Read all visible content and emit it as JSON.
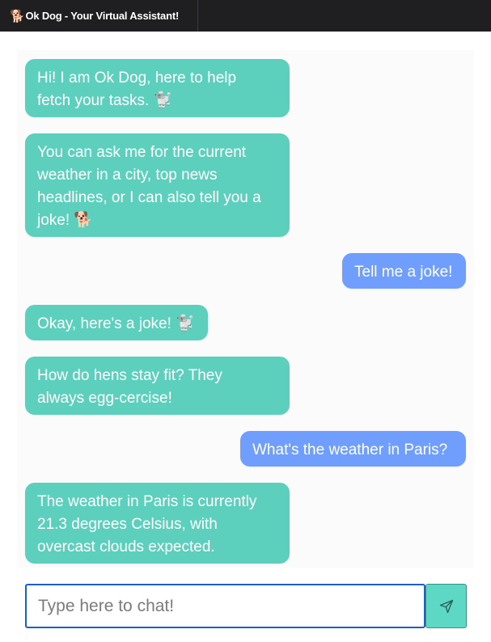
{
  "header": {
    "title": "Ok Dog - Your Virtual Assistant!",
    "icon": "dog-icon"
  },
  "messages": [
    {
      "sender": "bot",
      "text": "Hi! I am Ok Dog, here to help\nfetch your tasks. 🐩"
    },
    {
      "sender": "bot",
      "text": "You can ask me for the current\nweather in a city, top news\nheadlines, or I can also tell you a\njoke! 🐕"
    },
    {
      "sender": "user",
      "text": "Tell me a joke!"
    },
    {
      "sender": "bot",
      "text": "Okay, here's a joke! 🐩"
    },
    {
      "sender": "bot",
      "text": "How do hens stay fit? They\nalways egg-cercise!"
    },
    {
      "sender": "user",
      "text": "What's the weather in Paris?"
    },
    {
      "sender": "bot",
      "text": "The weather in Paris is currently\n21.3 degrees Celsius, with\novercast clouds expected."
    }
  ],
  "composer": {
    "placeholder": "Type here to chat!",
    "value": "",
    "send_icon": "send-icon"
  },
  "colors": {
    "bot_bubble": "#5dcfbd",
    "user_bubble": "#6f9eff",
    "topbar": "#1f1f22",
    "send_button": "#5dd8c4",
    "input_border": "#1f5fc4"
  }
}
